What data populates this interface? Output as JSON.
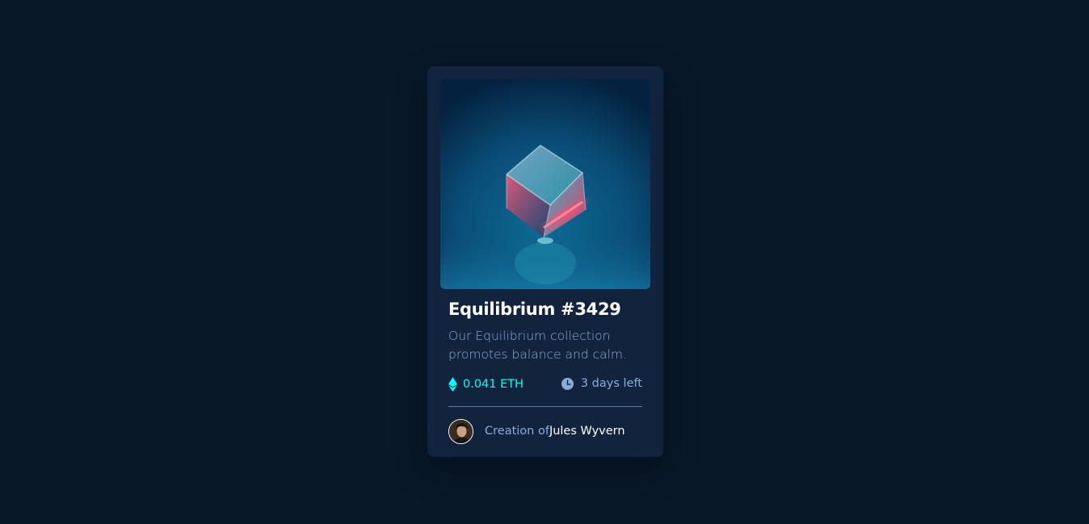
{
  "card": {
    "image": {
      "alt": "Equilibrium cube image"
    },
    "title": "Equilibrium #3429",
    "description": "Our Equilibrium collection promotes balance and calm.",
    "price": {
      "value": "0.041 ETH",
      "icon": "ethereum-icon"
    },
    "time": {
      "value": "3 days left",
      "icon": "clock-icon"
    },
    "creator": {
      "prefix": "Creation of",
      "name": "Jules Wyvern",
      "avatar_icon": "avatar"
    }
  },
  "colors": {
    "background": "#081829",
    "card": "#12243d",
    "accent": "#00fff8",
    "soft_blue": "#8bacd9",
    "white": "#ffffff"
  }
}
